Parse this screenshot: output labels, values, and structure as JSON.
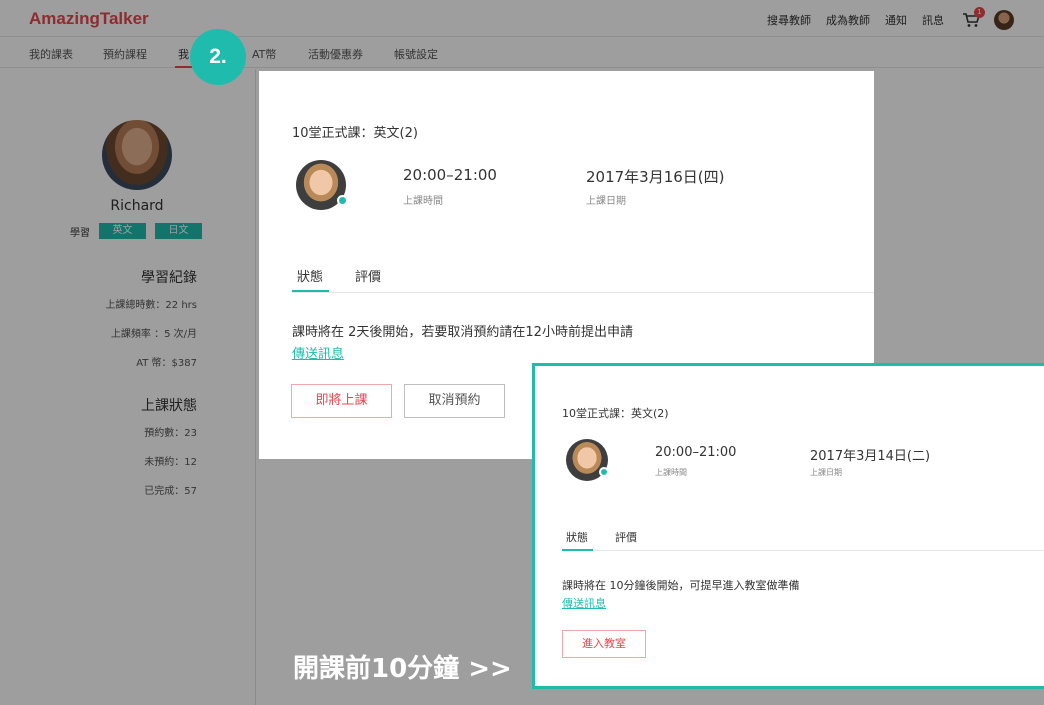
{
  "header": {
    "logo": "AmazingTalker",
    "nav": [
      "搜尋教師",
      "成為教師",
      "通知",
      "訊息"
    ],
    "cart_badge": "1"
  },
  "subnav": {
    "tabs": [
      "我的課表",
      "預約課程",
      "我",
      "AT幣",
      "活動優惠券",
      "帳號設定"
    ]
  },
  "sidebar": {
    "name": "Richard",
    "learn_label": "學習",
    "languages": [
      "英文",
      "日文"
    ],
    "record_title": "學習紀錄",
    "record_stats": [
      "上課總時數：22 hrs",
      "上課頻率 ：5 次/月",
      "AT 幣：$387"
    ],
    "status_title": "上課狀態",
    "status_stats": [
      "預約數：23",
      "未預約：12",
      "已完成：57"
    ]
  },
  "step_badge": "2.",
  "modal1": {
    "title": "10堂正式課：英文(2)",
    "time_value": "20:00–21:00",
    "time_label": "上課時間",
    "date_value": "2017年3月16日(四)",
    "date_label": "上課日期",
    "tabs": [
      "狀態",
      "評價"
    ],
    "message": "課時將在 2天後開始，若要取消預約請在12小時前提出申請",
    "link": "傳送訊息",
    "primary_button": "即將上課",
    "secondary_button": "取消預約"
  },
  "caption": "開課前10分鐘 >>",
  "modal2": {
    "title": "10堂正式課：英文(2)",
    "time_value": "20:00–21:00",
    "time_label": "上課時間",
    "date_value": "2017年3月14日(二)",
    "date_label": "上課日期",
    "tabs": [
      "狀態",
      "評價"
    ],
    "message": "課時將在 10分鐘後開始，可提早進入教室做準備",
    "link": "傳送訊息",
    "primary_button": "進入教室"
  },
  "colors": {
    "brand_red": "#e5484d",
    "accent_teal": "#1fbcae"
  }
}
